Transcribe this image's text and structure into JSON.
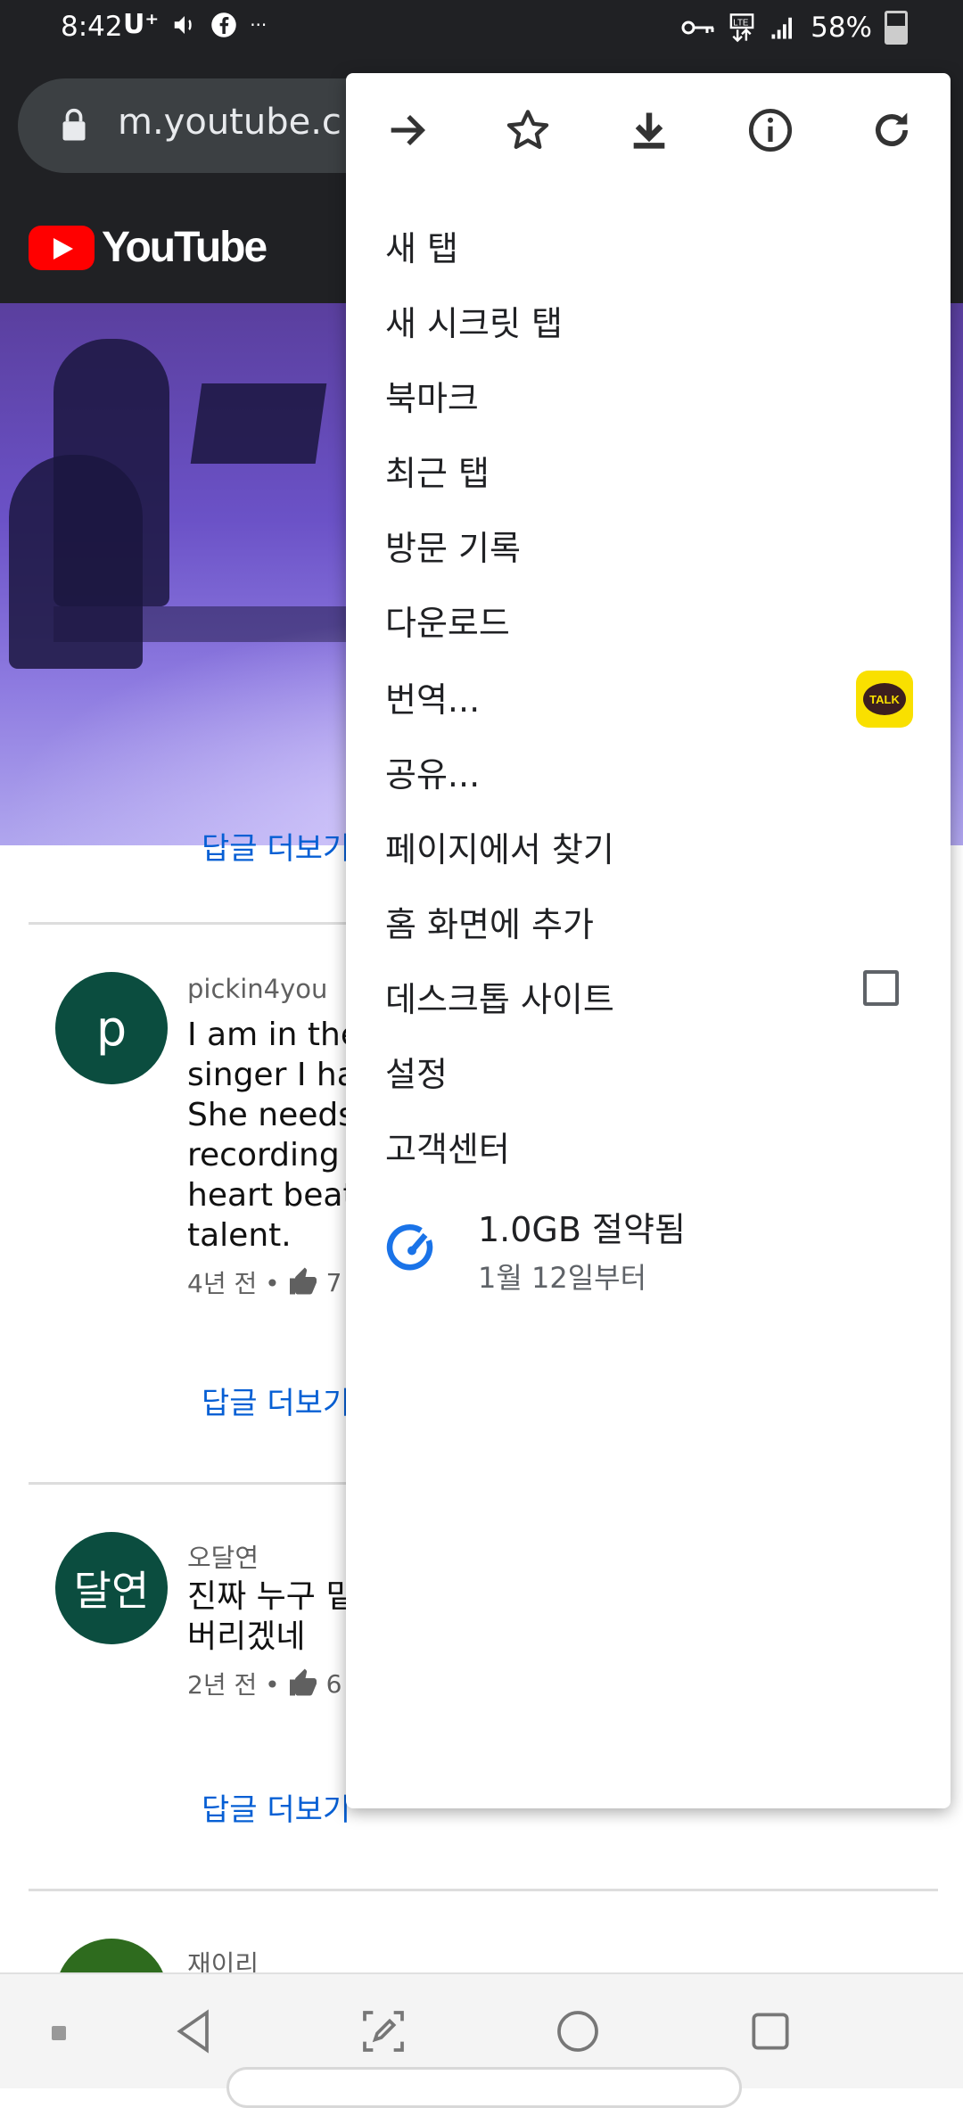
{
  "status_bar": {
    "time": "8:42",
    "carrier": "U⁺",
    "battery": "58%"
  },
  "address_bar": {
    "url": "m.youtube.c"
  },
  "youtube": {
    "wordmark": "YouTube"
  },
  "comments": [
    {
      "avatar_letter": "p",
      "avatar_color": "#0b4d3f",
      "author": "pickin4you",
      "text_lines": [
        "I am in the",
        "singer I hav",
        "She needs",
        "recording c",
        "heart beat.",
        "talent."
      ],
      "age": "4년 전 •",
      "likes": "7",
      "reply_label": "답글 더보기"
    },
    {
      "avatar_letter": "달연",
      "avatar_color": "#0b4d3f",
      "author": "오달연",
      "text_lines": [
        "진짜 누구 밑",
        "버리겠네"
      ],
      "age": "2년 전 •",
      "likes": "6",
      "reply_label": "답글 더보기"
    },
    {
      "avatar_color": "#2e6b1e",
      "author": "재이리"
    }
  ],
  "partial_reply_label": "답글 더보기",
  "menu": {
    "top_icons": [
      "forward-icon",
      "bookmark-star-icon",
      "download-icon",
      "info-icon",
      "refresh-icon"
    ],
    "items": [
      "새 탭",
      "새 시크릿 탭",
      "북마크",
      "최근 탭",
      "방문 기록",
      "다운로드",
      "번역...",
      "공유...",
      "페이지에서 찾기",
      "홈 화면에 추가",
      "데스크톱 사이트",
      "설정",
      "고객센터"
    ],
    "share_app": "TALK",
    "desktop_site_checked": false,
    "data_saver": {
      "title": "1.0GB 절약됨",
      "subtitle": "1월 12일부터"
    }
  },
  "colors": {
    "chrome_bg": "#202124",
    "link_blue": "#065fd4",
    "accent_blue": "#1a73e8",
    "youtube_red": "#ff0000"
  }
}
